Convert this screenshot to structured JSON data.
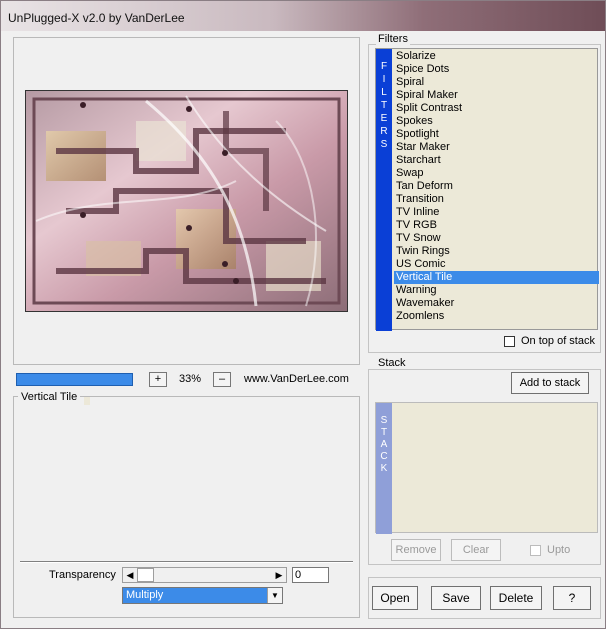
{
  "window": {
    "title": "UnPlugged-X v2.0 by VanDerLee"
  },
  "preview": {
    "zoom_in_label": "+",
    "zoom_level": "33%",
    "zoom_out_label": "–",
    "website": "www.VanDerLee.com"
  },
  "description": {
    "filter_name": "Vertical Tile"
  },
  "controls": {
    "transparency_label": "Transparency",
    "transparency_value": "0",
    "blend_mode": "Multiply"
  },
  "filters": {
    "group_label": "Filters",
    "side_letters": [
      "F",
      "I",
      "L",
      "T",
      "E",
      "R",
      "S"
    ],
    "items": [
      "Solarize",
      "Spice Dots",
      "Spiral",
      "Spiral Maker",
      "Split Contrast",
      "Spokes",
      "Spotlight",
      "Star Maker",
      "Starchart",
      "Swap",
      "Tan Deform",
      "Transition",
      "TV Inline",
      "TV RGB",
      "TV Snow",
      "Twin Rings",
      "US Comic",
      "Vertical Tile",
      "Warning",
      "Wavemaker",
      "Zoomlens"
    ],
    "selected": "Vertical Tile",
    "on_top_label": "On top of stack"
  },
  "stack": {
    "group_label": "Stack",
    "add_label": "Add to stack",
    "side_letters": [
      "S",
      "T",
      "A",
      "C",
      "K"
    ],
    "remove_label": "Remove",
    "clear_label": "Clear",
    "upto_label": "Upto"
  },
  "actions": {
    "open_label": "Open",
    "save_label": "Save",
    "delete_label": "Delete",
    "help_label": "?"
  },
  "colors": {
    "accent": "#3c8be8",
    "filters_bar": "#0a3fd6",
    "stack_bar": "#8f9fd8",
    "list_bg": "#ece9d8"
  }
}
